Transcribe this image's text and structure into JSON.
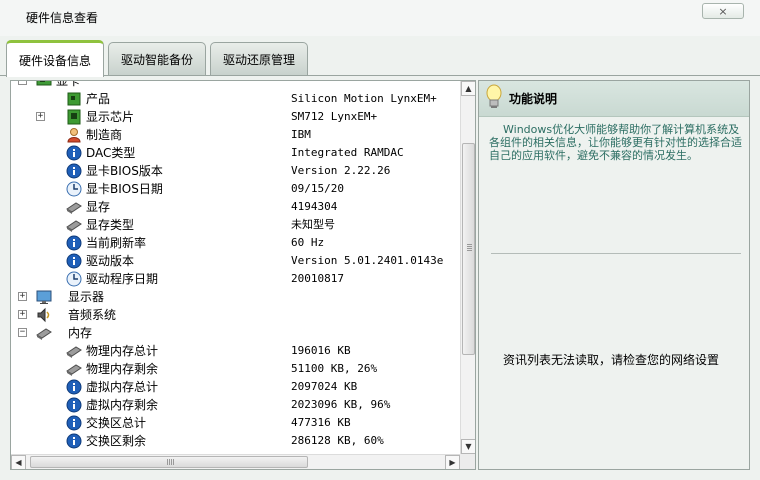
{
  "window": {
    "title": "硬件信息查看",
    "close_icon": "×"
  },
  "tabs": [
    {
      "label": "硬件设备信息",
      "active": true
    },
    {
      "label": "驱动智能备份",
      "active": false
    },
    {
      "label": "驱动还原管理",
      "active": false
    }
  ],
  "tree": {
    "partial_top_label": "显卡",
    "rows": [
      {
        "label": "产品",
        "value": "Silicon Motion LynxEM+",
        "icon": "chip-icon"
      },
      {
        "label": "显示芯片",
        "value": "SM712 LynxEM+",
        "icon": "chip-icon",
        "expander": "+"
      },
      {
        "label": "制造商",
        "value": "IBM",
        "icon": "person-icon"
      },
      {
        "label": "DAC类型",
        "value": "Integrated RAMDAC",
        "icon": "info-icon"
      },
      {
        "label": "显卡BIOS版本",
        "value": "Version 2.22.26",
        "icon": "info-icon"
      },
      {
        "label": "显卡BIOS日期",
        "value": "09/15/20",
        "icon": "clock-icon"
      },
      {
        "label": "显存",
        "value": "4194304",
        "icon": "memory-icon"
      },
      {
        "label": "显存类型",
        "value": "未知型号",
        "icon": "memory-icon"
      },
      {
        "label": "当前刷新率",
        "value": "60 Hz",
        "icon": "info-icon"
      },
      {
        "label": "驱动版本",
        "value": "Version 5.01.2401.0143e",
        "icon": "info-icon"
      },
      {
        "label": "驱动程序日期",
        "value": "20010817",
        "icon": "clock-icon"
      },
      {
        "label": "显示器",
        "value": "",
        "icon": "monitor-icon",
        "expander": "+",
        "top_level": true
      },
      {
        "label": "音频系统",
        "value": "",
        "icon": "speaker-icon",
        "expander": "+",
        "top_level": true
      },
      {
        "label": "内存",
        "value": "",
        "icon": "memory-icon",
        "expander": "−",
        "top_level": true
      },
      {
        "label": "物理内存总计",
        "value": "196016 KB",
        "icon": "memory-icon"
      },
      {
        "label": "物理内存剩余",
        "value": "51100 KB, 26%",
        "icon": "memory-icon"
      },
      {
        "label": "虚拟内存总计",
        "value": "2097024 KB",
        "icon": "info-icon"
      },
      {
        "label": "虚拟内存剩余",
        "value": "2023096 KB, 96%",
        "icon": "info-icon"
      },
      {
        "label": "交换区总计",
        "value": "477316 KB",
        "icon": "info-icon"
      },
      {
        "label": "交换区剩余",
        "value": "286128 KB, 60%",
        "icon": "info-icon"
      }
    ]
  },
  "scroll_icons": {
    "up": "▲",
    "down": "▼",
    "left": "◀",
    "right": "▶"
  },
  "info_panel": {
    "title": "功能说明",
    "description": "    Windows优化大师能够帮助你了解计算机系统及各组件的相关信息，让你能够更有针对性的选择合适自己的应用软件，避免不兼容的情况发生。",
    "message": "资讯列表无法读取，请检查您的网络设置"
  },
  "colors": {
    "accent_green": "#8fc23e",
    "info_blue": "#1f5fb8",
    "desc_text": "#2c6e63"
  }
}
